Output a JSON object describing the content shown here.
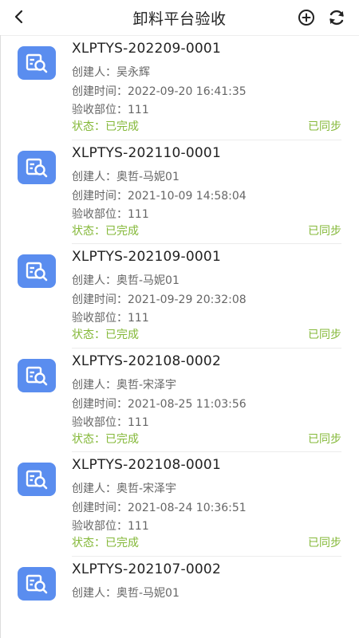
{
  "header": {
    "title": "卸料平台验收"
  },
  "labels": {
    "creator": "创建人：",
    "created_time": "创建时间：",
    "part": "验收部位：",
    "status_prefix": "状态："
  },
  "records": [
    {
      "code": "XLPTYS-202209-0001",
      "creator": "吴永辉",
      "created_time": "2022-09-20 16:41:35",
      "part": "111",
      "status": "已完成",
      "sync": "已同步"
    },
    {
      "code": "XLPTYS-202110-0001",
      "creator": "奥哲-马妮01",
      "created_time": "2021-10-09 14:58:04",
      "part": "111",
      "status": "已完成",
      "sync": "已同步"
    },
    {
      "code": "XLPTYS-202109-0001",
      "creator": "奥哲-马妮01",
      "created_time": "2021-09-29 20:32:08",
      "part": "111",
      "status": "已完成",
      "sync": "已同步"
    },
    {
      "code": "XLPTYS-202108-0002",
      "creator": "奥哲-宋泽宇",
      "created_time": "2021-08-25 11:03:56",
      "part": "111",
      "status": "已完成",
      "sync": "已同步"
    },
    {
      "code": "XLPTYS-202108-0001",
      "creator": "奥哲-宋泽宇",
      "created_time": "2021-08-24 10:36:51",
      "part": "111",
      "status": "已完成",
      "sync": "已同步"
    },
    {
      "code": "XLPTYS-202107-0002",
      "creator": "奥哲-马妮01"
    }
  ],
  "icons": {
    "back": "chevron-left-icon",
    "add": "plus-circle-icon",
    "sync": "refresh-icon",
    "record": "document-search-icon"
  },
  "colors": {
    "accent_blue": "#5a8def",
    "status_green": "#84b838"
  }
}
